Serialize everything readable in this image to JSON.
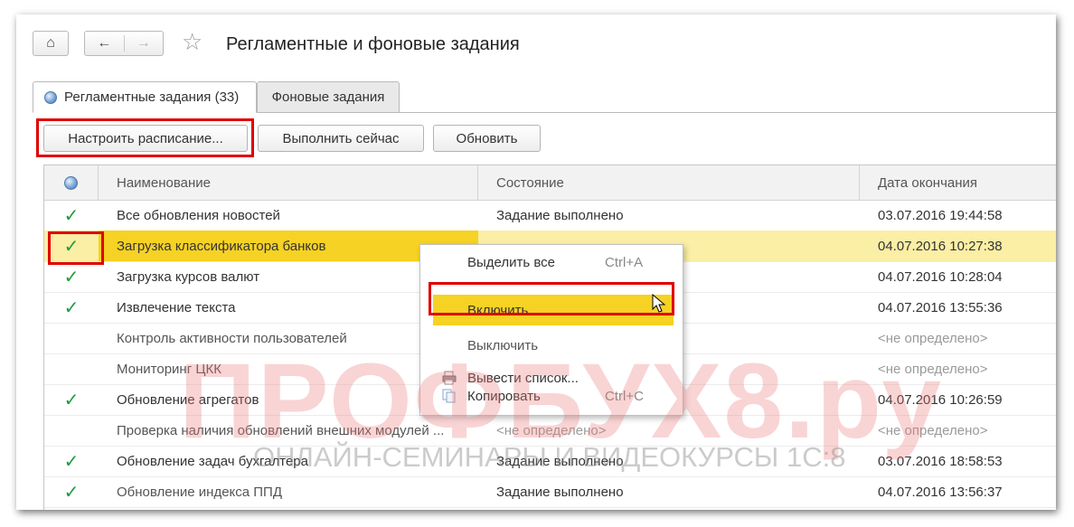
{
  "header": {
    "home_icon": "⌂",
    "back_icon": "←",
    "forward_icon": "→",
    "star_icon": "☆",
    "title": "Регламентные и фоновые задания"
  },
  "tabs": [
    {
      "label": "Регламентные задания (33)",
      "active": true
    },
    {
      "label": "Фоновые задания",
      "active": false
    }
  ],
  "toolbar": {
    "schedule_label": "Настроить расписание...",
    "run_now_label": "Выполнить сейчас",
    "refresh_label": "Обновить"
  },
  "table": {
    "columns": {
      "name": "Наименование",
      "state": "Состояние",
      "end_date": "Дата окончания"
    },
    "rows": [
      {
        "check": "✓",
        "name": "Все обновления новостей",
        "state": "Задание выполнено",
        "date": "03.07.2016 19:44:58"
      },
      {
        "check": "✓",
        "name": "Загрузка классификатора банков",
        "state": "",
        "date": "04.07.2016 10:27:38"
      },
      {
        "check": "✓",
        "name": "Загрузка курсов валют",
        "state": "",
        "date": "04.07.2016 10:28:04"
      },
      {
        "check": "✓",
        "name": "Извлечение текста",
        "state": "",
        "date": "04.07.2016 13:55:36"
      },
      {
        "check": "",
        "name": "Контроль активности пользователей",
        "state": "",
        "date": "<не определено>"
      },
      {
        "check": "",
        "name": "Мониторинг ЦКК",
        "state": "",
        "date": "<не определено>"
      },
      {
        "check": "✓",
        "name": "Обновление агрегатов",
        "state": "",
        "date": "04.07.2016 10:26:59"
      },
      {
        "check": "",
        "name": "Проверка наличия обновлений внешних модулей ...",
        "state": "<не определено>",
        "date": "<не определено>"
      },
      {
        "check": "✓",
        "name": "Обновление задач бухгалтера",
        "state": "Задание выполнено",
        "date": "03.07.2016 18:58:53"
      },
      {
        "check": "✓",
        "name": "Обновление индекса ППД",
        "state": "Задание выполнено",
        "date": "04.07.2016 13:56:37"
      }
    ]
  },
  "context_menu": {
    "select_all": "Выделить все",
    "select_all_shortcut": "Ctrl+A",
    "enable": "Включить",
    "disable": "Выключить",
    "export_list": "Вывести список...",
    "copy": "Копировать",
    "copy_shortcut": "Ctrl+C"
  },
  "watermark": {
    "brand": "ПРОФБУХ8.ру",
    "tagline": "ОНЛАЙН-СЕМИНАРЫ И ВИДЕОКУРСЫ 1С:8"
  },
  "colors": {
    "selection": "#f6d224",
    "selected_row": "#fbeea5",
    "check": "#1e9b3e",
    "highlight": "#e00000"
  }
}
